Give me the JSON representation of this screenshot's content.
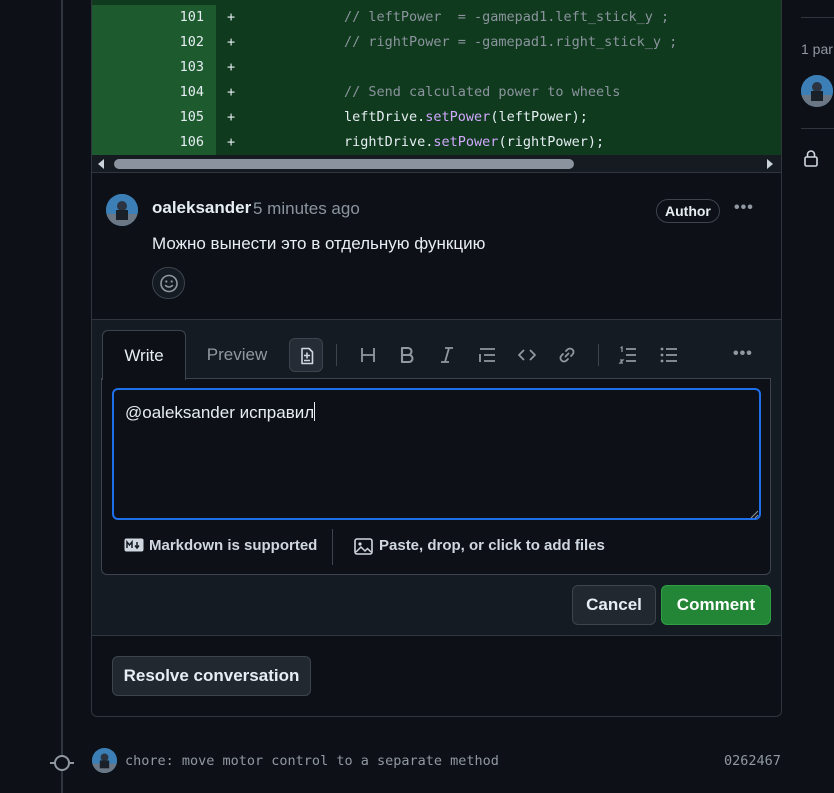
{
  "diff": {
    "rows": [
      {
        "num": "101",
        "sign": "+",
        "code": [
          {
            "t": "// leftPower  = -gamepad1.left_stick_y ;",
            "c": "comment"
          }
        ]
      },
      {
        "num": "102",
        "sign": "+",
        "code": [
          {
            "t": "// rightPower = -gamepad1.right_stick_y ;",
            "c": "comment"
          }
        ]
      },
      {
        "num": "103",
        "sign": "+",
        "code": []
      },
      {
        "num": "104",
        "sign": "+",
        "code": [
          {
            "t": "// Send calculated power to wheels",
            "c": "comment"
          }
        ]
      },
      {
        "num": "105",
        "sign": "+",
        "code": [
          {
            "t": "leftDrive.",
            "c": ""
          },
          {
            "t": "setPower",
            "c": "method"
          },
          {
            "t": "(leftPower);",
            "c": ""
          }
        ]
      },
      {
        "num": "106",
        "sign": "+",
        "code": [
          {
            "t": "rightDrive.",
            "c": ""
          },
          {
            "t": "setPower",
            "c": "method"
          },
          {
            "t": "(rightPower);",
            "c": ""
          }
        ]
      }
    ]
  },
  "comment": {
    "author": "oaleksander",
    "time": "5 minutes ago",
    "badge": "Author",
    "body": "Можно вынести это в отдельную функцию",
    "more_icon": "kebab-horizontal-icon",
    "reaction_icon": "smiley-icon"
  },
  "editor": {
    "tabs": {
      "write": "Write",
      "preview": "Preview"
    },
    "toolbar_icons": [
      "diff-icon",
      "heading-icon",
      "bold-icon",
      "italic-icon",
      "quote-icon",
      "code-icon",
      "link-icon",
      "ordered-list-icon",
      "unordered-list-icon",
      "more-icon"
    ],
    "value": "@oaleksander исправил",
    "markdown_note": "Markdown is supported",
    "attach_note": "Paste, drop, or click to add files"
  },
  "actions": {
    "cancel": "Cancel",
    "comment": "Comment",
    "resolve": "Resolve conversation"
  },
  "commit": {
    "message": "chore: move motor control to a separate method",
    "sha": "0262467"
  },
  "sidebar": {
    "participants_text": "1 par"
  },
  "colors": {
    "accent_blue": "#1f6feb",
    "comment_green": "#238636",
    "diff_added_bg": "#0f3a1d"
  }
}
